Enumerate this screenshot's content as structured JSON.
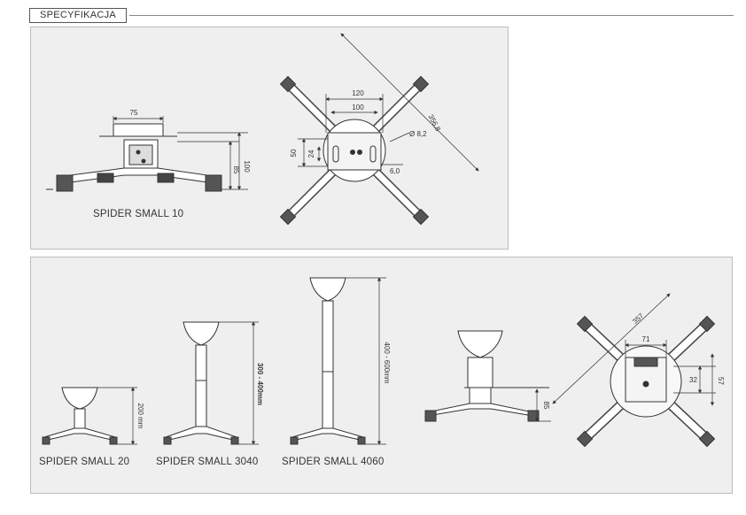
{
  "header": {
    "section_title": "SPECYFIKACJA"
  },
  "top_panel": {
    "model_label": "SPIDER SMALL 10",
    "dims": {
      "width_75": "75",
      "height_85": "85",
      "height_100": "100",
      "w120": "120",
      "w100": "100",
      "diag": "356,8",
      "hole": "Ø 8,2",
      "h50": "50",
      "h24": "24",
      "w60": "6,0"
    }
  },
  "bottom_panel": {
    "labels": {
      "small20": "SPIDER SMALL 20",
      "small3040": "SPIDER SMALL 3040",
      "small4060": "SPIDER SMALL 4060"
    },
    "dims": {
      "h200": "200 mm",
      "h3040": "300 - 400mm",
      "h4060": "400 - 600mm",
      "h85": "85",
      "diag357": "357",
      "w71": "71",
      "h32": "32",
      "h57": "57"
    }
  },
  "colors": {
    "panel_bg": "#efefef",
    "line": "#333333"
  }
}
